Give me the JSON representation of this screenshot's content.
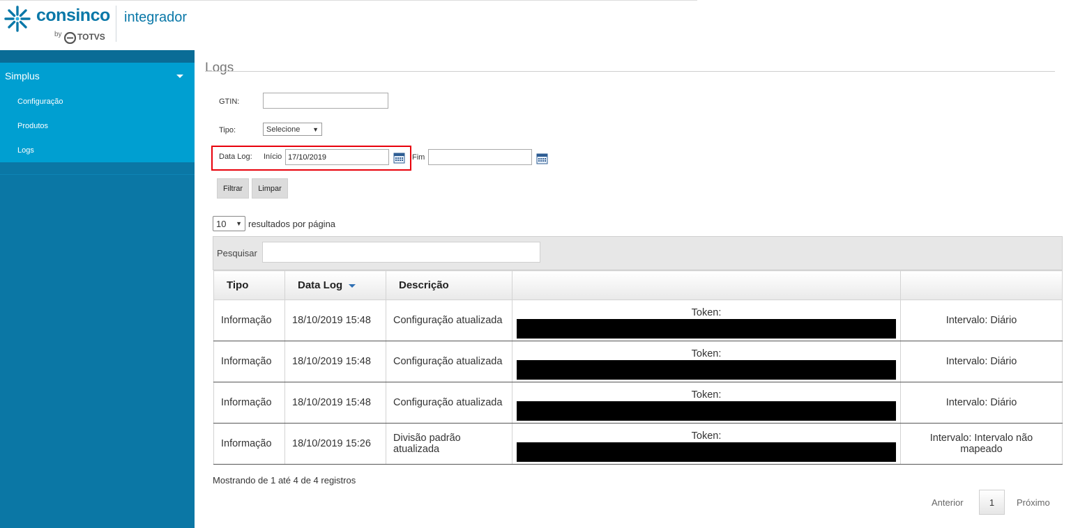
{
  "header": {
    "brand": "consinco",
    "by": "by",
    "totvs": "TOTVS",
    "product": "integrador"
  },
  "colors": {
    "brand_blue": "#0a78a8",
    "sidebar_bg": "#0b77a5",
    "sidebar_active": "#009fd1",
    "highlight_red": "#e8000b"
  },
  "sidebar": {
    "group_label": "Simplus",
    "items": [
      {
        "label": "Configuração"
      },
      {
        "label": "Produtos"
      },
      {
        "label": "Logs"
      }
    ]
  },
  "page": {
    "title": "Logs"
  },
  "filters": {
    "gtin_label": "GTIN:",
    "gtin_value": "",
    "tipo_label": "Tipo:",
    "tipo_selected": "Selecione",
    "datalog_label": "Data Log:",
    "inicio_label": "Início",
    "inicio_value": "17/10/2019",
    "fim_label": "Fim",
    "fim_value": "",
    "filtrar_label": "Filtrar",
    "limpar_label": "Limpar"
  },
  "listing": {
    "page_size": "10",
    "page_size_label": "resultados por página",
    "search_label": "Pesquisar",
    "search_value": ""
  },
  "table": {
    "columns": [
      "Tipo",
      "Data Log",
      "Descrição",
      "",
      ""
    ],
    "sorted_column": "Data Log",
    "rows": [
      {
        "tipo": "Informação",
        "data": "18/10/2019 15:48",
        "descricao": "Configuração atualizada",
        "token": "Token:",
        "intervalo": "Intervalo: Diário"
      },
      {
        "tipo": "Informação",
        "data": "18/10/2019 15:48",
        "descricao": "Configuração atualizada",
        "token": "Token:",
        "intervalo": "Intervalo: Diário"
      },
      {
        "tipo": "Informação",
        "data": "18/10/2019 15:48",
        "descricao": "Configuração atualizada",
        "token": "Token:",
        "intervalo": "Intervalo: Diário"
      },
      {
        "tipo": "Informação",
        "data": "18/10/2019 15:26",
        "descricao": "Divisão padrão atualizada",
        "token": "Token:",
        "intervalo": "Intervalo: Intervalo não mapeado"
      }
    ]
  },
  "footer": {
    "info": "Mostrando de 1 até 4 de 4 registros",
    "prev": "Anterior",
    "current_page": "1",
    "next": "Próximo"
  }
}
